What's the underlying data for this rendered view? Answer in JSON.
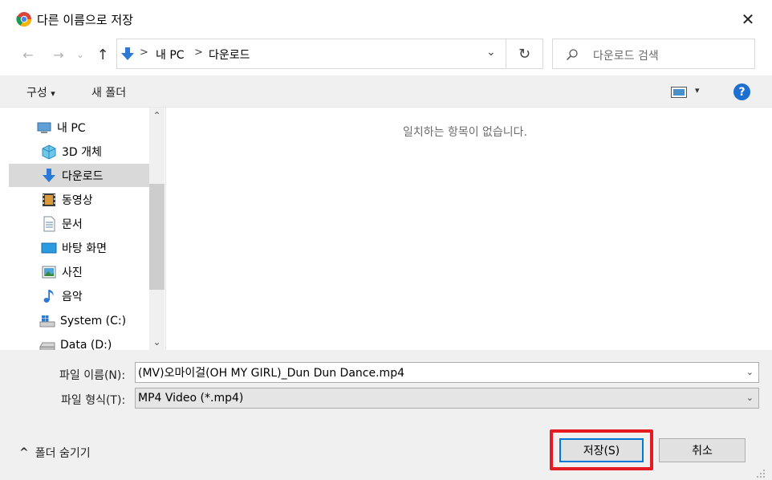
{
  "window": {
    "title": "다른 이름으로 저장",
    "close_glyph": "✕"
  },
  "nav": {
    "back_glyph": "←",
    "forward_glyph": "→",
    "history_glyph": "⌄",
    "up_glyph": "↑",
    "breadcrumb": [
      "내 PC",
      "다운로드"
    ],
    "separator": ">",
    "dropdown_glyph": "⌄",
    "refresh_glyph": "↻",
    "search_placeholder": "다운로드 검색"
  },
  "toolbar": {
    "organize_label": "구성",
    "organize_caret": "▾",
    "new_folder_label": "새 폴더",
    "view_caret": "▾",
    "help_glyph": "?"
  },
  "sidebar": {
    "items": [
      {
        "label": "내 PC",
        "icon": "pc-icon"
      },
      {
        "label": "3D 개체",
        "icon": "3d-objects-icon"
      },
      {
        "label": "다운로드",
        "icon": "download-icon",
        "selected": true
      },
      {
        "label": "동영상",
        "icon": "video-icon"
      },
      {
        "label": "문서",
        "icon": "document-icon"
      },
      {
        "label": "바탕 화면",
        "icon": "desktop-icon"
      },
      {
        "label": "사진",
        "icon": "pictures-icon"
      },
      {
        "label": "음악",
        "icon": "music-icon"
      },
      {
        "label": "System (C:)",
        "icon": "drive-c-icon"
      },
      {
        "label": "Data (D:)",
        "icon": "drive-d-icon"
      }
    ],
    "scroll_up": "⌃",
    "scroll_down": "⌄"
  },
  "content": {
    "empty_message": "일치하는 항목이 없습니다."
  },
  "form": {
    "filename_label": "파일 이름(N):",
    "filename_value": "(MV)오마이걸(OH MY GIRL)_Dun Dun Dance.mp4",
    "filetype_label": "파일 형식(T):",
    "filetype_value": "MP4 Video (*.mp4)",
    "chevron": "⌄"
  },
  "footer": {
    "hide_folders_caret": "^",
    "hide_folders_label": "폴더 숨기기",
    "save_label": "저장(S)",
    "cancel_label": "취소"
  },
  "colors": {
    "accent": "#0078d7",
    "highlight": "#e41b22",
    "help": "#1e6fd0"
  }
}
